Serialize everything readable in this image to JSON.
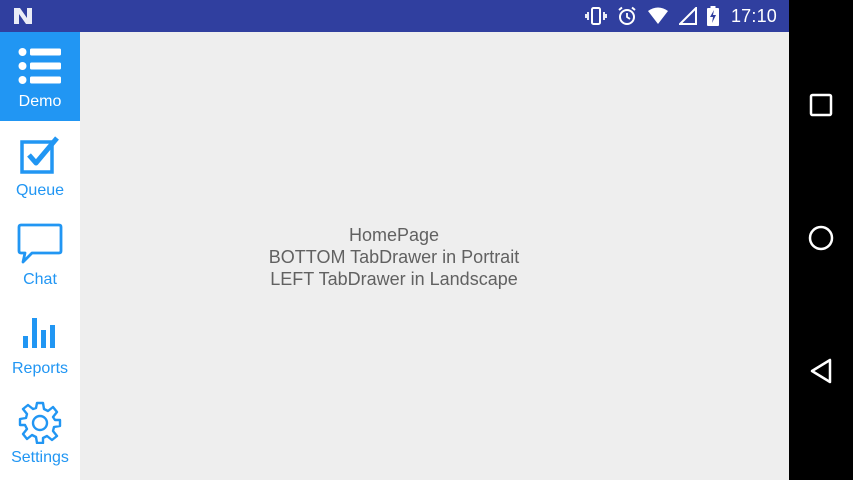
{
  "status_bar": {
    "time": "17:10",
    "icons": [
      "n-notification-icon",
      "vibrate-icon",
      "alarm-icon",
      "wifi-icon",
      "signal-icon",
      "battery-charging-icon"
    ]
  },
  "tab_drawer": {
    "accent_color": "#2196f3",
    "active_tab": "Demo",
    "tabs": [
      {
        "label": "Demo",
        "icon": "list-icon"
      },
      {
        "label": "Queue",
        "icon": "checkbox-icon"
      },
      {
        "label": "Chat",
        "icon": "chat-bubble-icon"
      },
      {
        "label": "Reports",
        "icon": "bar-chart-icon"
      },
      {
        "label": "Settings",
        "icon": "gear-icon"
      }
    ]
  },
  "content": {
    "line1": "HomePage",
    "line2": "BOTTOM TabDrawer in Portrait",
    "line3": "LEFT TabDrawer in Landscape"
  },
  "nav_bar": {
    "buttons": [
      "recents-icon",
      "home-icon",
      "back-icon"
    ]
  }
}
